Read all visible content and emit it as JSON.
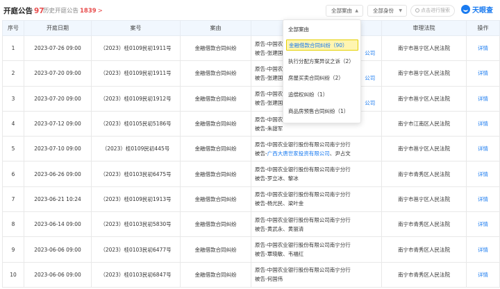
{
  "header": {
    "title": "开庭公告",
    "title_count": "97",
    "history_label": "历史开庭公告",
    "history_count": "1839",
    "history_arrow": ">",
    "filter_case_reason": "全部案由",
    "filter_identity": "全部身份",
    "caret": "▲",
    "caret_down": "▼",
    "search_placeholder": "点击进行搜索",
    "logo_text": "天眼查"
  },
  "columns": [
    "序号",
    "开庭日期",
    "案号",
    "案由",
    "当事人",
    "审理法院",
    "操作"
  ],
  "rows": [
    {
      "no": "1",
      "date": "2023-07-26 09:00",
      "case_no": "（2023）桂0109民初1911号",
      "reason": "金融借款合同纠纷",
      "line1": "原告-中国农",
      "line1_link": "",
      "line2": "被告-张建国",
      "line2_link": "公司",
      "court": "南宁市邕宁区人民法院",
      "action": "详情"
    },
    {
      "no": "2",
      "date": "2023-07-20 09:00",
      "case_no": "（2023）桂0109民初1911号",
      "reason": "金融借款合同纠纷",
      "line1": "原告-中国农",
      "line1_link": "",
      "line2": "被告-张建国",
      "line2_link": "公司",
      "court": "南宁市邕宁区人民法院",
      "action": "详情"
    },
    {
      "no": "3",
      "date": "2023-07-20 09:00",
      "case_no": "（2023）桂0109民初1912号",
      "reason": "金融借款合同纠纷",
      "line1": "原告-中国农",
      "line1_link": "",
      "line2": "被告-张建国",
      "line2_link": "公司",
      "court": "南宁市邕宁区人民法院",
      "action": "详情"
    },
    {
      "no": "4",
      "date": "2023-07-12 09:00",
      "case_no": "（2023）桂0105民初5186号",
      "reason": "金融借款合同纠纷",
      "line1": "原告-中国农",
      "line1_link": "",
      "line2": "被告-朱甜军",
      "line2_link": "",
      "court": "南宁市江南区人民法院",
      "action": "详情"
    },
    {
      "no": "5",
      "date": "2023-07-10 09:00",
      "case_no": "（2023）桂0109民初445号",
      "reason": "金融借款合同纠纷",
      "line1": "原告-中国农业银行股份有限公司南宁分行",
      "line1_link": "",
      "line2": "被告-",
      "line2_link": "广西大唐世家投资有限公司",
      "line2_tail": "、尹占文",
      "court": "南宁市邕宁区人民法院",
      "action": "详情"
    },
    {
      "no": "6",
      "date": "2023-06-26 09:00",
      "case_no": "（2023）桂0103民初6475号",
      "reason": "金融借款合同纠纷",
      "line1": "原告-中国农业银行股份有限公司南宁分行",
      "line1_link": "",
      "line2": "被告-罗立冰、黎冰",
      "line2_link": "",
      "court": "南宁市青秀区人民法院",
      "action": "详情"
    },
    {
      "no": "7",
      "date": "2023-06-21 10:24",
      "case_no": "（2023）桂0109民初1913号",
      "reason": "金融借款合同纠纷",
      "line1": "原告-中国农业银行股份有限公司南宁分行",
      "line1_link": "",
      "line2": "被告-杨光民、梁叶金",
      "line2_link": "",
      "court": "南宁市邕宁区人民法院",
      "action": "详情"
    },
    {
      "no": "8",
      "date": "2023-06-14 09:00",
      "case_no": "（2023）桂0103民初5830号",
      "reason": "金融借款合同纠纷",
      "line1": "原告-中国农业银行股份有限公司南宁分行",
      "line1_link": "",
      "line2": "被告-黄武永、黄丽清",
      "line2_link": "",
      "court": "南宁市青秀区人民法院",
      "action": "详情"
    },
    {
      "no": "9",
      "date": "2023-06-06 09:00",
      "case_no": "（2023）桂0103民初6477号",
      "reason": "金融借款合同纠纷",
      "line1": "原告-中国农业银行股份有限公司南宁分行",
      "line1_link": "",
      "line2": "被告-覃晓敏、韦福红",
      "line2_link": "",
      "court": "南宁市青秀区人民法院",
      "action": "详情"
    },
    {
      "no": "10",
      "date": "2023-06-06 09:00",
      "case_no": "（2023）桂0103民初6847号",
      "reason": "金融借款合同纠纷",
      "line1": "原告-中国农业银行股份有限公司南宁分行",
      "line1_link": "",
      "line2": "被告-何国伟",
      "line2_link": "",
      "court": "南宁市青秀区人民法院",
      "action": "详情"
    }
  ],
  "dropdown": {
    "items": [
      "全部案由",
      "金融借款合同纠纷（90）",
      "执行分配方案异议之诉（2）",
      "房屋买卖合同纠纷（2）",
      "追偿权纠纷（1）",
      "商品房预售合同纠纷（1）"
    ]
  },
  "colors": {
    "accent": "#1a7bf0",
    "count": "#e84d4d",
    "highlight": "#fff5b0",
    "header_bg": "#f1f7fe"
  }
}
